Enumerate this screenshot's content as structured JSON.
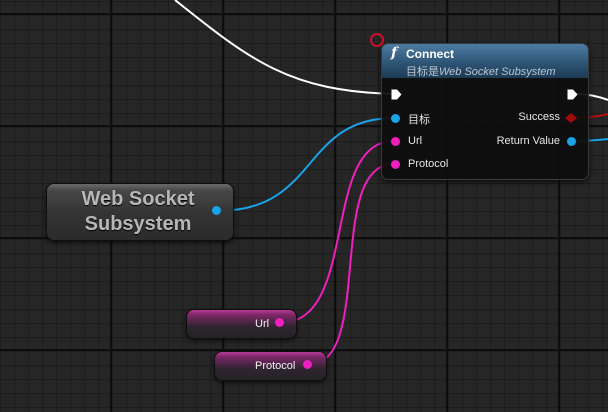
{
  "function_node": {
    "icon": "function-icon",
    "title": "Connect",
    "subtitle_prefix": "目标是",
    "subtitle_target": "Web Socket Subsystem",
    "inputs": {
      "target": "目标",
      "url": "Url",
      "protocol": "Protocol"
    },
    "outputs": {
      "success": "Success",
      "return_value": "Return Value"
    }
  },
  "variable_nodes": {
    "subsystem": {
      "line1": "Web Socket",
      "line2": "Subsystem"
    },
    "url": {
      "label": "Url"
    },
    "protocol": {
      "label": "Protocol"
    }
  },
  "colors": {
    "exec_wire": "#ffffff",
    "object_pin": "#1aa3e8",
    "string_pin": "#f01fc0",
    "bool_pin": "#9e0a0a",
    "node_header": "#2f5575",
    "breakpoint": "#c8102e"
  }
}
